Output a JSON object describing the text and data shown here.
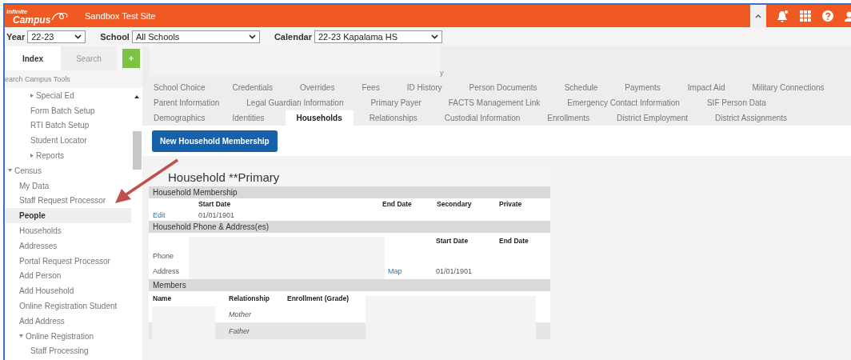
{
  "header": {
    "logo": [
      "Infinite",
      "Campus"
    ],
    "site_name": "Sandbox Test Site"
  },
  "filters": [
    {
      "label": "Year",
      "value": "22-23"
    },
    {
      "label": "School",
      "value": "All Schools"
    },
    {
      "label": "Calendar",
      "value": "22-23 Kapalama HS"
    }
  ],
  "sidebar": {
    "tabs": [
      {
        "label": "Index",
        "selected": true
      },
      {
        "label": "Search",
        "selected": false
      }
    ],
    "search_placeholder": "earch Campus Tools",
    "partial_branch": [
      {
        "label": "Special Ed",
        "expanded": false,
        "selected": false
      },
      {
        "label": "Form Batch Setup",
        "selected": false
      },
      {
        "label": "RTI Batch Setup",
        "selected": false
      },
      {
        "label": "Student Locator",
        "selected": false
      },
      {
        "label": "Reports",
        "expanded": false,
        "selected": false
      }
    ],
    "items": [
      {
        "label": "Census",
        "expanded": true,
        "selected": false,
        "children": [
          {
            "label": "My Data",
            "selected": false
          },
          {
            "label": "Staff Request Processor",
            "selected": false
          },
          {
            "label": "People",
            "selected": true
          },
          {
            "label": "Households",
            "selected": false
          },
          {
            "label": "Addresses",
            "selected": false
          },
          {
            "label": "Portal Request Processor",
            "selected": false
          },
          {
            "label": "Add Person",
            "selected": false
          },
          {
            "label": "Add Household",
            "selected": false
          },
          {
            "label": "Online Registration Student",
            "selected": false
          },
          {
            "label": "Add Address",
            "selected": false
          },
          {
            "label": "Online Registration",
            "expanded": true,
            "selected": false,
            "children": [
              {
                "label": "Staff Processing",
                "selected": false
              }
            ]
          }
        ]
      }
    ]
  },
  "breadcrumb_fragment": "y",
  "tab_rows": [
    [
      {
        "label": "School Choice",
        "selected": false
      },
      {
        "label": "Credentials",
        "selected": false
      },
      {
        "label": "Overrides",
        "selected": false
      },
      {
        "label": "Fees",
        "selected": false
      },
      {
        "label": "ID History",
        "selected": false
      },
      {
        "label": "Person Documents",
        "selected": false
      },
      {
        "label": "Schedule",
        "selected": false
      },
      {
        "label": "Payments",
        "selected": false
      },
      {
        "label": "Impact Aid",
        "selected": false
      },
      {
        "label": "Military Connections",
        "selected": false
      }
    ],
    [
      {
        "label": "Parent Information",
        "selected": false
      },
      {
        "label": "Legal Guardian Information",
        "selected": false
      },
      {
        "label": "Primary Payer",
        "selected": false
      },
      {
        "label": "FACTS Management Link",
        "selected": false
      },
      {
        "label": "Emergency Contact Information",
        "selected": false
      },
      {
        "label": "SIF Person Data",
        "selected": false
      }
    ],
    [
      {
        "label": "Demographics",
        "selected": false
      },
      {
        "label": "Identities",
        "selected": false
      },
      {
        "label": "Households",
        "selected": true
      },
      {
        "label": "Relationships",
        "selected": false
      },
      {
        "label": "Custodial Information",
        "selected": false
      },
      {
        "label": "Enrollments",
        "selected": false
      },
      {
        "label": "District Employment",
        "selected": false
      },
      {
        "label": "District Assignments",
        "selected": false
      }
    ]
  ],
  "new_button": "New Household Membership",
  "panel": {
    "title": "Household **Primary",
    "membership": {
      "heading": "Household Membership",
      "columns": [
        "Start Date",
        "End Date",
        "Secondary",
        "Private"
      ],
      "row": {
        "action": "Edit",
        "start_date": "01/01/1901"
      }
    },
    "phone_address": {
      "heading": "Household Phone & Address(es)",
      "columns": [
        "Start Date",
        "End Date"
      ],
      "phone_label": "Phone",
      "address_label": "Address",
      "map_link": "Map",
      "start_date": "01/01/1901"
    },
    "members": {
      "heading": "Members",
      "columns": [
        "Name",
        "Relationship",
        "Enrollment (Grade)"
      ],
      "rows": [
        {
          "relationship": "Mother"
        },
        {
          "relationship": "Father"
        }
      ]
    }
  }
}
